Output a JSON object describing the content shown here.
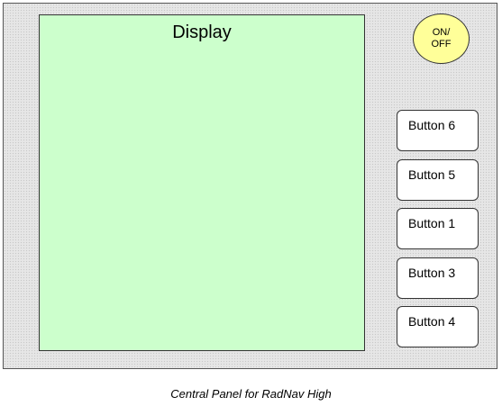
{
  "display": {
    "label": "Display",
    "background": "#ccffcc"
  },
  "power": {
    "line1": "ON/",
    "line2": "OFF",
    "color": "#ffff99"
  },
  "buttons": [
    {
      "label": "Button 6"
    },
    {
      "label": "Button 5"
    },
    {
      "label": "Button 1"
    },
    {
      "label": "Button 3"
    },
    {
      "label": "Button 4"
    }
  ],
  "caption": "Central Panel for RadNav High"
}
